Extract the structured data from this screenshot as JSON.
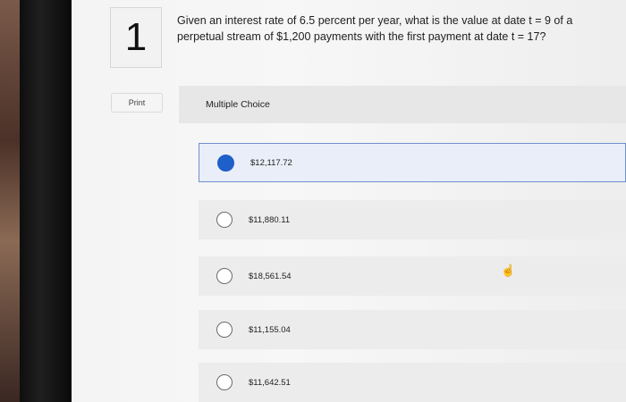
{
  "question_number": "1",
  "question_text": "Given an interest rate of 6.5 percent per year, what is the value at date t = 9 of a perpetual stream of $1,200 payments with the first payment at date t = 17?",
  "print_label": "Print",
  "multiple_choice_label": "Multiple Choice",
  "options": [
    {
      "label": "$12,117.72",
      "selected": true
    },
    {
      "label": "$11,880.11",
      "selected": false
    },
    {
      "label": "$18,561.54",
      "selected": false
    },
    {
      "label": "$11,155.04",
      "selected": false
    },
    {
      "label": "$11,642.51",
      "selected": false
    }
  ],
  "colors": {
    "selected_accent": "#1f5fc9"
  },
  "icons": {
    "cursor": "hand-pointer-icon"
  }
}
